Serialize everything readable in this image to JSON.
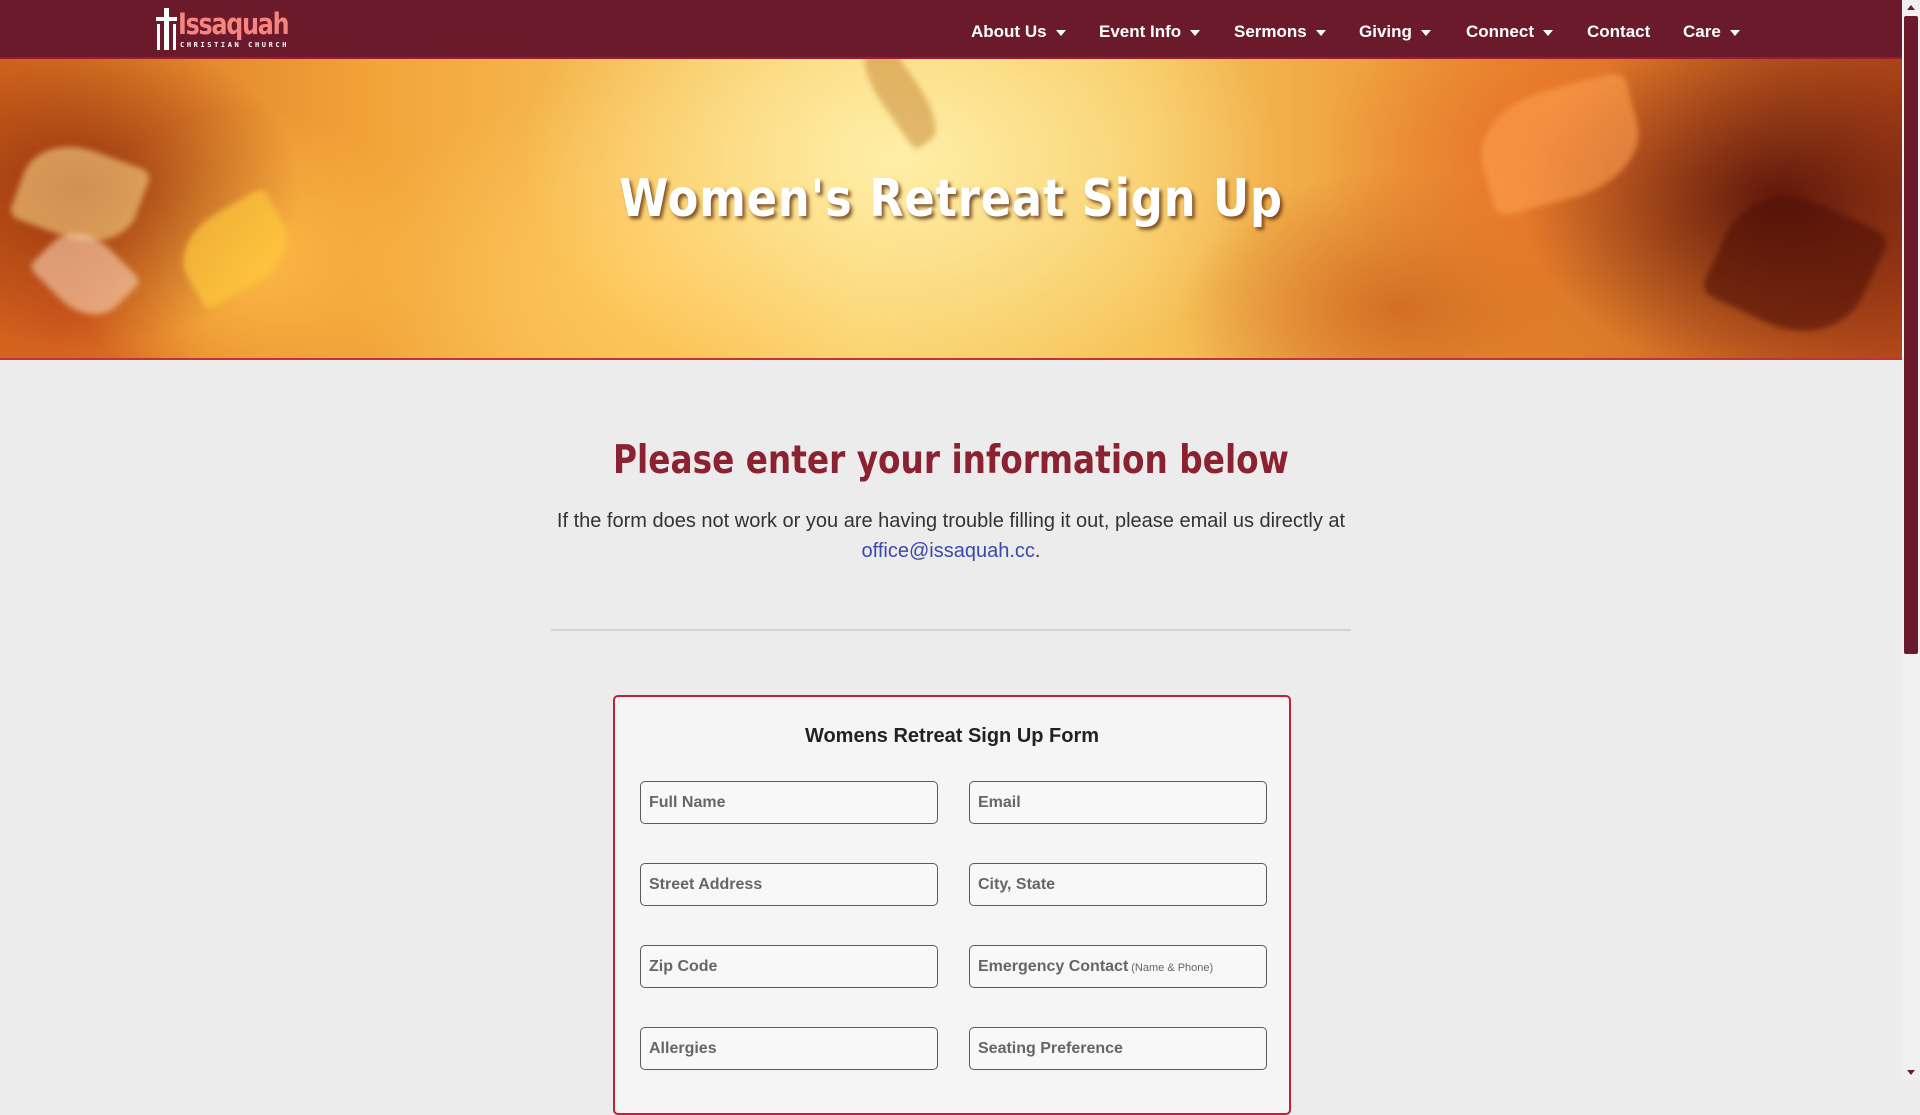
{
  "brand": {
    "logo_word": "Issaquah",
    "logo_sub": "CHRISTIAN CHURCH",
    "colors": {
      "header": "#6b1a2c",
      "heading": "#8b2232",
      "form_border": "#c0213a",
      "link": "#3b4aa8"
    }
  },
  "nav": {
    "items": [
      {
        "label": "About Us",
        "dropdown": true
      },
      {
        "label": "Event Info",
        "dropdown": true
      },
      {
        "label": "Sermons",
        "dropdown": true
      },
      {
        "label": "Giving",
        "dropdown": true
      },
      {
        "label": "Connect",
        "dropdown": true
      },
      {
        "label": "Contact",
        "dropdown": false
      },
      {
        "label": "Care",
        "dropdown": true
      }
    ]
  },
  "hero": {
    "title": "Women's Retreat Sign Up"
  },
  "main": {
    "heading": "Please enter your information below",
    "intro_text": "If the form does not work or you are having trouble filling it out, please email us directly at",
    "email_link": "office@issaquah.cc",
    "intro_end": "."
  },
  "form": {
    "title": "Womens Retreat Sign Up Form",
    "fields": {
      "full_name": {
        "placeholder": "Full Name",
        "value": ""
      },
      "email": {
        "placeholder": "Email",
        "value": ""
      },
      "street_address": {
        "placeholder": "Street Address",
        "value": ""
      },
      "city_state": {
        "placeholder": "City, State",
        "value": ""
      },
      "zip_code": {
        "placeholder": "Zip Code",
        "value": ""
      },
      "emergency_contact": {
        "placeholder": "Emergency Contact",
        "hint": "(Name & Phone)",
        "value": ""
      },
      "allergies": {
        "placeholder": "Allergies",
        "value": ""
      },
      "seating_preference": {
        "placeholder": "Seating Preference",
        "value": ""
      }
    }
  }
}
